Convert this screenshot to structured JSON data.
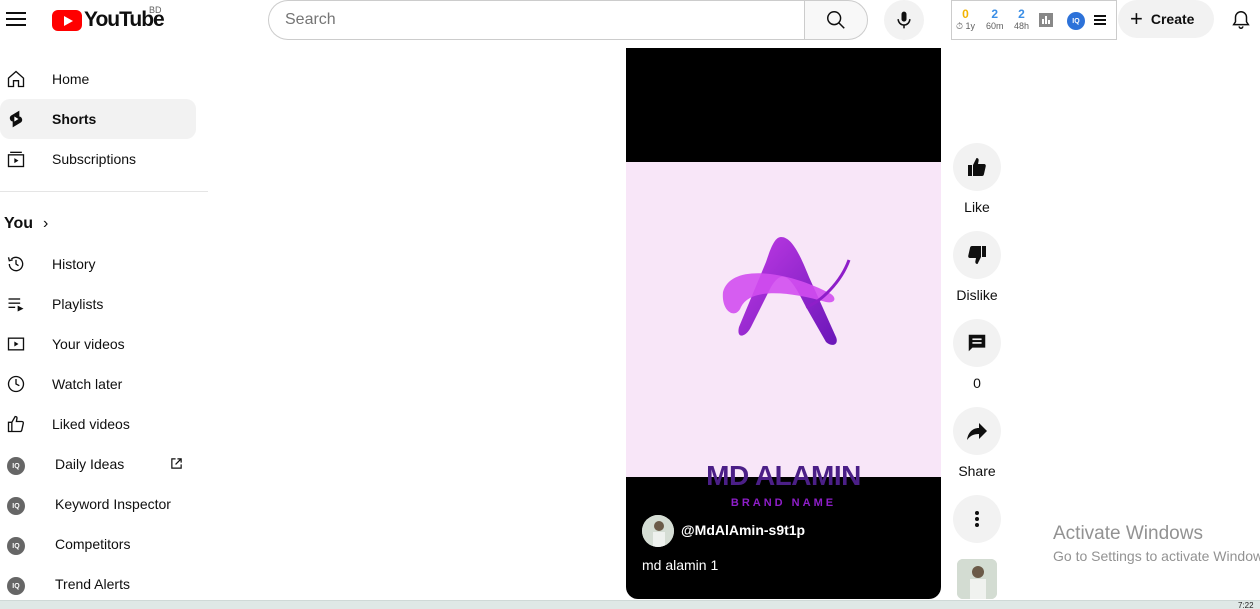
{
  "header": {
    "logo_text": "YouTube",
    "country_code": "BD",
    "search_placeholder": "Search",
    "extension_stats": [
      {
        "num": "0",
        "label": "⏱ 1y",
        "color": "#f2b300"
      },
      {
        "num": "2",
        "label": "60m",
        "color": "#3a8ee6"
      },
      {
        "num": "2",
        "label": "48h",
        "color": "#3a8ee6"
      }
    ],
    "create_label": "Create"
  },
  "sidebar": {
    "main": [
      {
        "label": "Home",
        "icon": "home-icon"
      },
      {
        "label": "Shorts",
        "icon": "shorts-icon",
        "active": true
      },
      {
        "label": "Subscriptions",
        "icon": "subscriptions-icon"
      }
    ],
    "you_title": "You",
    "you_items": [
      {
        "label": "History",
        "icon": "history-icon"
      },
      {
        "label": "Playlists",
        "icon": "playlists-icon"
      },
      {
        "label": "Your videos",
        "icon": "your-videos-icon"
      },
      {
        "label": "Watch later",
        "icon": "watch-later-icon"
      },
      {
        "label": "Liked videos",
        "icon": "liked-videos-icon"
      }
    ],
    "iq_items": [
      {
        "label": "Daily Ideas",
        "external": true
      },
      {
        "label": "Keyword Inspector"
      },
      {
        "label": "Competitors"
      },
      {
        "label": "Trend Alerts"
      }
    ],
    "iq_badge": "IQ"
  },
  "short": {
    "brand_name": "MD ALAMIN",
    "brand_sub": "BRAND NAME",
    "channel": "@MdAlAmin-s9t1p",
    "title": "md alamin 1"
  },
  "actions": {
    "like_label": "Like",
    "dislike_label": "Dislike",
    "comments_count": "0",
    "share_label": "Share"
  },
  "watermark": {
    "line1": "Activate Windows",
    "line2": "Go to Settings to activate Windows."
  },
  "taskbar": {
    "time": "7:22"
  },
  "colors": {
    "brand_red": "#ff0000",
    "logo_purple": "#8e1ec9",
    "logo_dark": "#4b1f87",
    "thumb_bg": "#f8e6f8"
  }
}
